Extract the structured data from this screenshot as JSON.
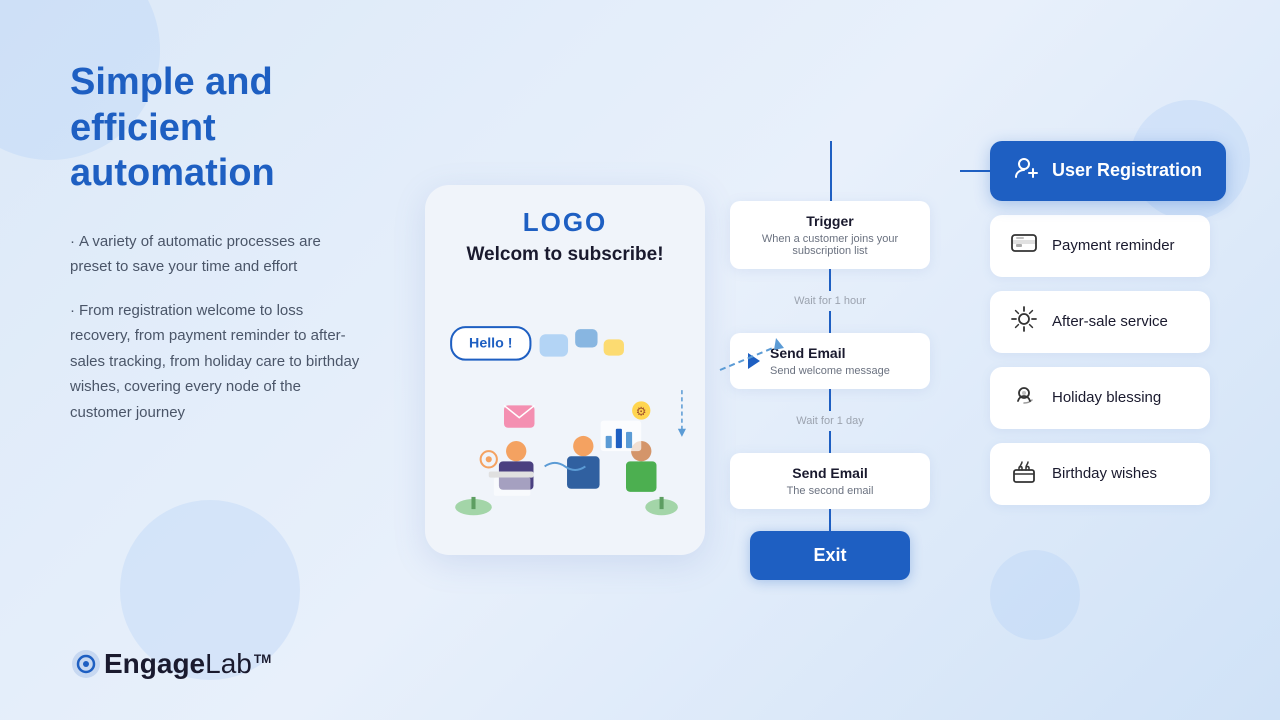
{
  "background": {
    "color": "#dce9f8"
  },
  "left": {
    "headline_line1": "Simple and efficient",
    "headline_line2": "automation",
    "bullet1": "A variety of automatic processes are preset to save your time and effort",
    "bullet2": "From registration welcome to loss recovery, from payment reminder to after-sales tracking, from holiday care to birthday wishes, covering every node of the customer journey",
    "logo_engage": "Engage",
    "logo_lab": "Lab",
    "logo_tm": "TM"
  },
  "phone": {
    "logo": "LOGO",
    "welcome": "Welcom to subscribe!",
    "hello": "Hello !"
  },
  "flowchart": {
    "user_reg_label": "User Registration",
    "trigger_title": "Trigger",
    "trigger_subtitle": "When a customer joins your subscription list",
    "wait1": "Wait for 1 hour",
    "email1_title": "Send Email",
    "email1_subtitle": "Send welcome message",
    "wait2": "Wait for 1 day",
    "email2_title": "Send Email",
    "email2_subtitle": "The second email",
    "exit_label": "Exit"
  },
  "cards": [
    {
      "icon": "💳",
      "label": "Payment reminder",
      "icon_name": "payment-icon"
    },
    {
      "icon": "🔧",
      "label": "After-sale service",
      "icon_name": "service-icon"
    },
    {
      "icon": "🎁",
      "label": "Holiday blessing",
      "icon_name": "holiday-icon"
    },
    {
      "icon": "🎂",
      "label": "Birthday wishes",
      "icon_name": "birthday-icon"
    }
  ]
}
